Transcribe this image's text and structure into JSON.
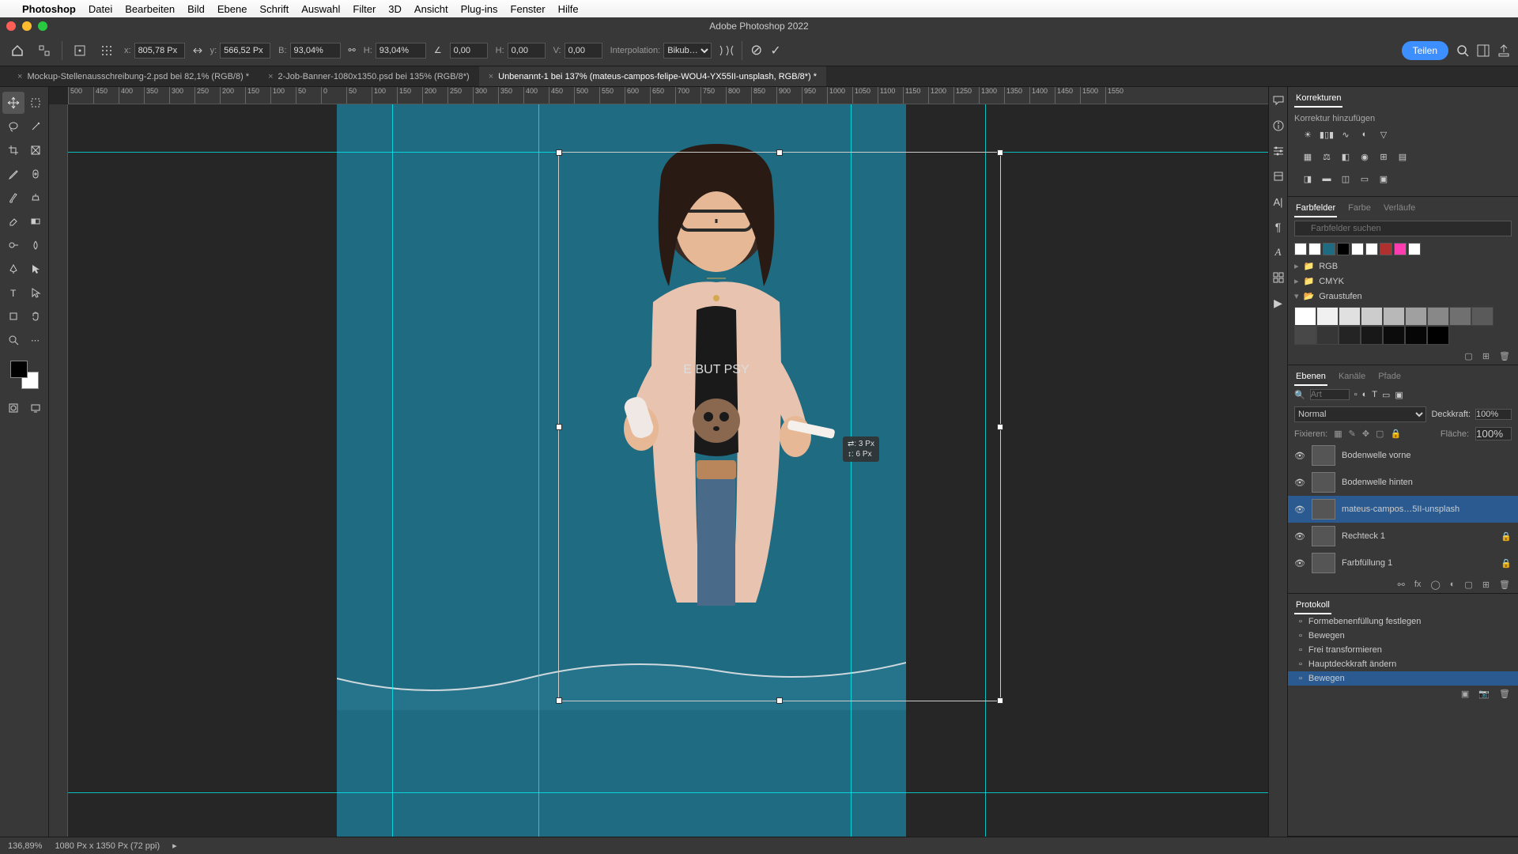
{
  "mac_menu": {
    "app": "Photoshop",
    "items": [
      "Datei",
      "Bearbeiten",
      "Bild",
      "Ebene",
      "Schrift",
      "Auswahl",
      "Filter",
      "3D",
      "Ansicht",
      "Plug-ins",
      "Fenster",
      "Hilfe"
    ]
  },
  "window_title": "Adobe Photoshop 2022",
  "options": {
    "x_label": "x:",
    "x_value": "805,78 Px",
    "y_label": "y:",
    "y_value": "566,52 Px",
    "b_label": "B:",
    "b_value": "93,04%",
    "h_label": "H:",
    "h_value": "93,04%",
    "rot_label": "",
    "rot_value": "0,00",
    "hskew_label": "H:",
    "hskew_value": "0,00",
    "vskew_label": "V:",
    "vskew_value": "0,00",
    "interp_label": "Interpolation:",
    "interp_value": "Bikub…",
    "share": "Teilen"
  },
  "tabs": [
    {
      "label": "Mockup-Stellenausschreibung-2.psd bei 82,1% (RGB/8) *",
      "active": false
    },
    {
      "label": "2-Job-Banner-1080x1350.psd bei 135% (RGB/8*)",
      "active": false
    },
    {
      "label": "Unbenannt-1 bei 137% (mateus-campos-felipe-WOU4-YX55II-unsplash, RGB/8*) *",
      "active": true
    }
  ],
  "ruler_h": [
    "500",
    "450",
    "400",
    "350",
    "300",
    "250",
    "200",
    "150",
    "100",
    "50",
    "0",
    "50",
    "100",
    "150",
    "200",
    "250",
    "300",
    "350",
    "400",
    "450",
    "500",
    "550",
    "600",
    "650",
    "700",
    "750",
    "800",
    "850",
    "900",
    "950",
    "1000",
    "1050",
    "1100",
    "1150",
    "1200",
    "1250",
    "1300",
    "1350",
    "1400",
    "1450",
    "1500",
    "1550"
  ],
  "delta": {
    "dx": "⇄: 3 Px",
    "dy": "↕: 6 Px"
  },
  "panels": {
    "korrekturen": {
      "title": "Korrekturen",
      "add": "Korrektur hinzufügen"
    },
    "farbfelder": {
      "tabs": [
        "Farbfelder",
        "Farbe",
        "Verläufe"
      ],
      "search_placeholder": "Farbfelder suchen",
      "folders": [
        "RGB",
        "CMYK",
        "Graustufen"
      ],
      "swatch_colors": [
        "#ffffff",
        "#ffffff",
        "#1e6b82",
        "#000000",
        "#ffffff",
        "#ffffff",
        "#b03030",
        "#ff3cb0",
        "#ffffff"
      ],
      "grays": [
        "#ffffff",
        "#f0f0f0",
        "#e0e0e0",
        "#cccccc",
        "#b8b8b8",
        "#a0a0a0",
        "#888888",
        "#707070",
        "#5a5a5a",
        "#484848",
        "#363636",
        "#242424",
        "#181818",
        "#0c0c0c",
        "#060606",
        "#000000"
      ]
    },
    "ebenen": {
      "tabs": [
        "Ebenen",
        "Kanäle",
        "Pfade"
      ],
      "search_placeholder": "Art",
      "blend_mode": "Normal",
      "opacity_label": "Deckkraft:",
      "opacity_value": "100%",
      "lock_label": "Fixieren:",
      "fill_label": "Fläche:",
      "fill_value": "100%",
      "layers": [
        {
          "name": "Bodenwelle vorne",
          "locked": false
        },
        {
          "name": "Bodenwelle hinten",
          "locked": false
        },
        {
          "name": "mateus-campos…5II-unsplash",
          "locked": false,
          "active": true
        },
        {
          "name": "Rechteck 1",
          "locked": true
        },
        {
          "name": "Farbfüllung 1",
          "locked": true
        }
      ]
    },
    "protokoll": {
      "title": "Protokoll",
      "items": [
        "Formebenenfüllung festlegen",
        "Bewegen",
        "Frei transformieren",
        "Hauptdeckkraft ändern",
        "Bewegen"
      ]
    }
  },
  "status": {
    "zoom": "136,89%",
    "doc_info": "1080 Px x 1350 Px (72 ppi)"
  }
}
